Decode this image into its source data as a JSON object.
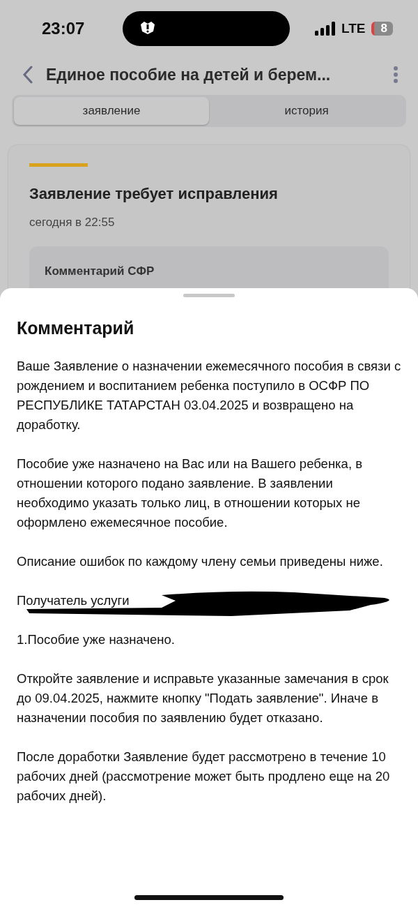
{
  "status_bar": {
    "time": "23:07",
    "network": "LTE",
    "battery": "8"
  },
  "header": {
    "title": "Единое пособие на детей и берем..."
  },
  "tabs": [
    {
      "label": "заявление",
      "selected": true
    },
    {
      "label": "история",
      "selected": false
    }
  ],
  "card": {
    "title": "Заявление требует исправления",
    "date": "сегодня в 22:55",
    "comment_label": "Комментарий СФР"
  },
  "sheet": {
    "title": "Комментарий",
    "paragraphs": [
      {
        "kind": "text",
        "text": "Ваше Заявление о назначении ежемесячного пособия в связи с рождением и воспитанием ребенка поступило в ОСФР ПО РЕСПУБЛИКЕ ТАТАРСТАН 03.04.2025 и возвращено на доработку."
      },
      {
        "kind": "text",
        "text": "Пособие уже назначено на Вас или на Вашего ребенка, в отношении которого подано заявление. В заявлении необходимо указать только лиц, в отношении которых не оформлено ежемесячное пособие."
      },
      {
        "kind": "text",
        "text": "Описание ошибок по каждому члену семьи приведены ниже."
      },
      {
        "kind": "redacted",
        "text": "Получатель услуги",
        "result": "1.Пособие уже назначено."
      },
      {
        "kind": "text",
        "text": "Откройте заявление и исправьте указанные замечания в срок до 09.04.2025, нажмите кнопку \"Подать заявление\". Иначе в назначении пособия по заявлению будет отказано."
      },
      {
        "kind": "text",
        "text": "После доработки Заявление будет рассмотрено в течение 10 рабочих дней (рассмотрение может быть продлено еще на 20 рабочих дней)."
      }
    ]
  }
}
